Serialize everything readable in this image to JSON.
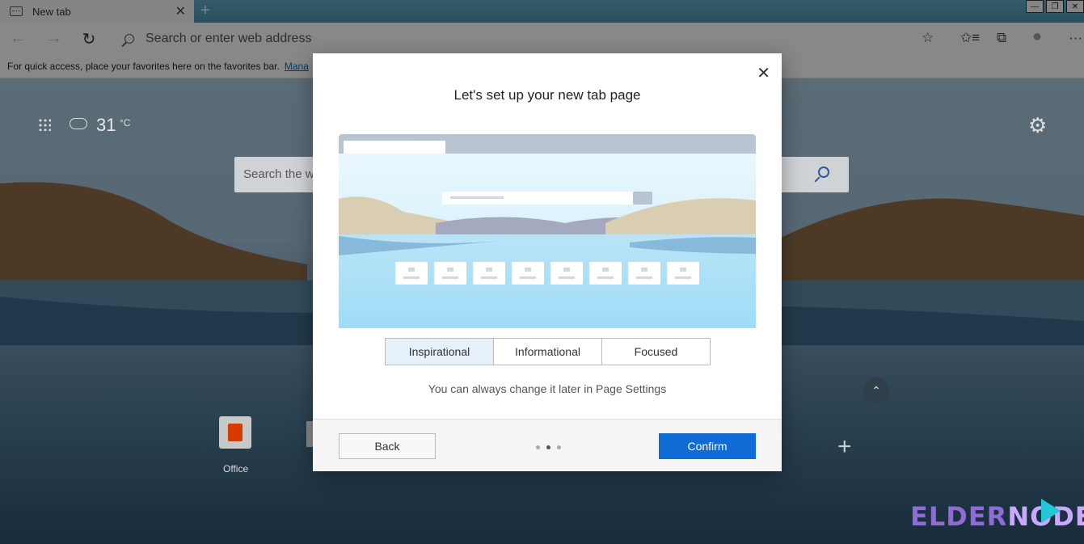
{
  "browser": {
    "tab_title": "New tab",
    "tab_close": "✕",
    "new_tab": "+",
    "window_buttons": [
      "—",
      "❐",
      "✕"
    ],
    "address_placeholder": "Search or enter web address",
    "back_icon": "←",
    "forward_icon": "→",
    "refresh_icon": "↻",
    "toolbar_icons": {
      "favorite": "☆",
      "favorites_list": "✩≡",
      "collections": "⧉",
      "profile": "●",
      "more": "···"
    }
  },
  "favorites_bar": {
    "text": "For quick access, place your favorites here on the favorites bar.",
    "link": "Mana"
  },
  "newtab_page": {
    "temperature": "31",
    "temp_unit": "°C",
    "search_placeholder": "Search the w",
    "tiles": [
      {
        "label": "Office"
      }
    ],
    "scroll_up": "⌃",
    "add_tile": "+"
  },
  "dialog": {
    "title": "Let's set up your new tab page",
    "close": "✕",
    "options": [
      "Inspirational",
      "Informational",
      "Focused"
    ],
    "selected_option": "Inspirational",
    "hint": "You can always change it later in Page Settings",
    "back_label": "Back",
    "confirm_label": "Confirm",
    "step": 2,
    "steps_total": 3
  },
  "watermark": {
    "text_a": "ELDER",
    "text_b": "NODE"
  },
  "colors": {
    "accent": "#0f6cd4",
    "selected_option_bg": "#e6f0f8"
  }
}
